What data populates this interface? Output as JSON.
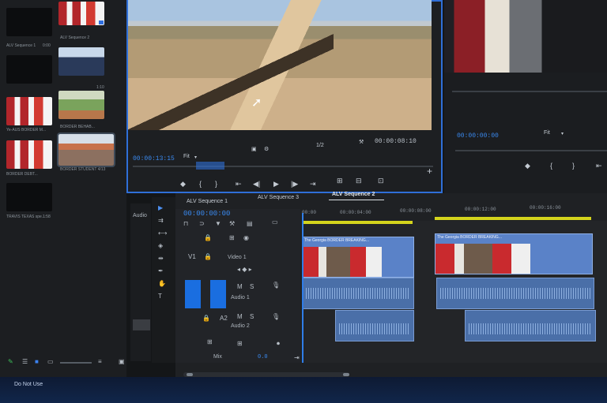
{
  "project_bin": {
    "items": [
      {
        "name": "ALV Sequence 1",
        "duration": "0:00"
      },
      {
        "name": "ALV Sequence 2",
        "duration": "0:00"
      },
      {
        "name": "",
        "duration": ""
      },
      {
        "name": "",
        "duration": "1:10"
      },
      {
        "name": "Ye-AUS BORDER M...",
        "duration": "1:17"
      },
      {
        "name": "BORDER BEHAB...",
        "duration": "3:08"
      },
      {
        "name": "BORDER DEBT...",
        "duration": "3:10:00"
      },
      {
        "name": "BORDER STUDENT 4/13",
        "duration": ""
      },
      {
        "name": "TRAVIS TEXAS spe...",
        "duration": "1:58"
      }
    ],
    "footer_status": "Do Not Use"
  },
  "source_monitor": {
    "timecode": "00:00:13:15",
    "fit": "Fit",
    "fraction": "1/2",
    "duration": "00:00:08:10"
  },
  "program_monitor": {
    "timecode": "00:00:00:00",
    "fit": "Fit"
  },
  "timeline": {
    "tabs": [
      "ALV Sequence 1",
      "ALV Sequence 3",
      "ALV Sequence 2"
    ],
    "active_tab": "ALV Sequence 2",
    "timecode": "00:00:00:00",
    "ruler": [
      "00:00",
      "00:00:04:00",
      "00:00:08:00",
      "00:00:12:00",
      "00:00:16:00"
    ],
    "tracks": {
      "video": "Video 1",
      "audio1": "Audio 1",
      "audio2": "Audio 2",
      "mix": "Mix",
      "mix_value": "0.0"
    },
    "clip1_title": "The Georgia BORDER BREAKING...",
    "clip2_title": "The Georgia BORDER BREAKING..."
  },
  "tools": {
    "label": "Audio"
  },
  "colors": {
    "accent": "#2f6fd8",
    "yellow": "#d4d41c",
    "clip": "#5a82c8"
  }
}
